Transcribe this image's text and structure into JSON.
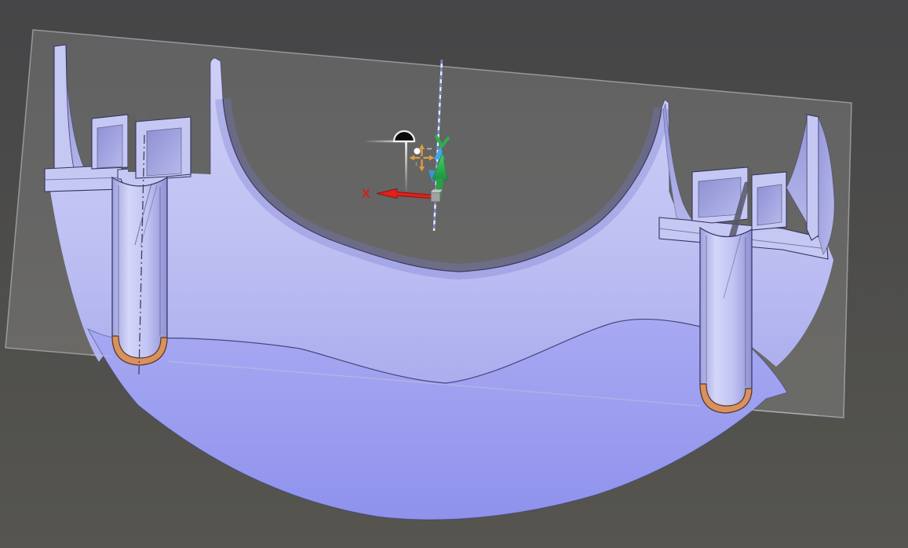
{
  "viewport": {
    "description": "CAD section-analysis view of a hemispherical part cut by a section plane",
    "background_top": "#454547",
    "background_bottom": "#56554f"
  },
  "section_plane": {
    "fill": "rgba(255,255,255,0.15)",
    "edge_color": "rgba(198,208,213,0.55)"
  },
  "model": {
    "cut_face_color": "#c6c8f4",
    "curved_face_dark": "#9395d8",
    "inner_surface_top": "#cdcff7",
    "inner_surface_bottom": "#abadee",
    "outer_dome_top": "#a7a9f2",
    "outer_dome_bottom": "#8f92ec",
    "edge_color": "#34345e",
    "fillet_highlight_color": "#d8915f",
    "fillet_edge_color": "#5c3a26",
    "centerline_color": "#3f3f5c",
    "void_gap_color": "#60605c"
  },
  "gizmo": {
    "axis_label": "X",
    "x_axis_color": "#e0201a",
    "x_label_color": "#cf2018",
    "y_axis_color": "#2fae4e",
    "z_axis_color": "#46a5e6",
    "z_line_white": "#eceef8",
    "z_line_blue": "#7282d2",
    "origin_handle_color": "#a2a2a2",
    "move_icon_color": "#dd9b43",
    "move_icon_dot": "#fdfdfd",
    "section_icon_fill": "#0a0a0a",
    "section_icon_outline": "#f2f2f2",
    "leader_color": "#ffffff"
  }
}
